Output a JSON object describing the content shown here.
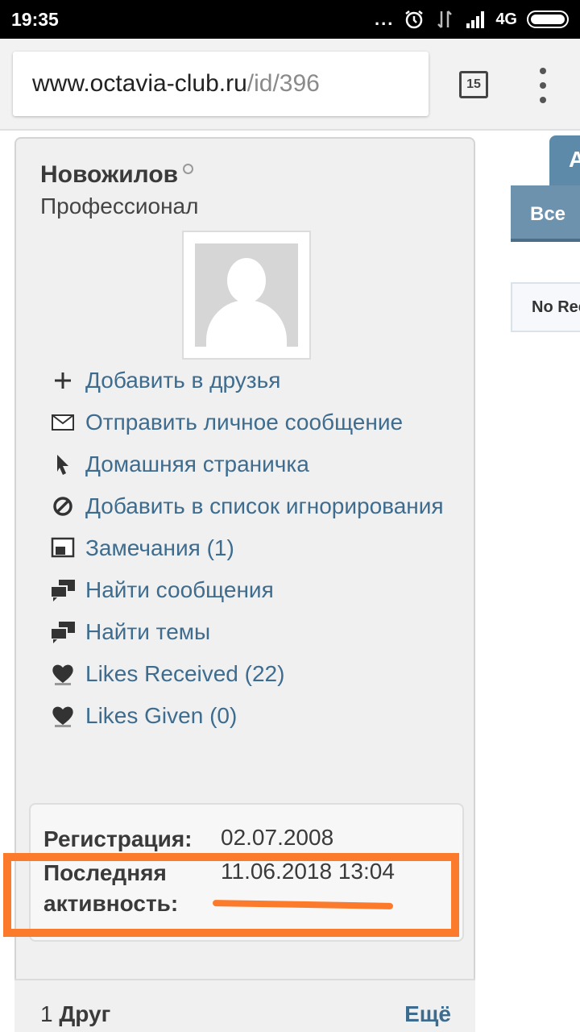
{
  "status_bar": {
    "time": "19:35",
    "dots": "...",
    "network": "4G"
  },
  "browser": {
    "url_host": "www.octavia-club.ru",
    "url_path": "/id/396",
    "tab_count": "15"
  },
  "profile": {
    "username": "Новожилов",
    "user_title": "Профессионал",
    "actions": [
      {
        "icon": "plus-icon",
        "label": "Добавить в друзья"
      },
      {
        "icon": "envelope-icon",
        "label": "Отправить личное сообщение"
      },
      {
        "icon": "cursor-icon",
        "label": "Домашняя страничка"
      },
      {
        "icon": "ban-icon",
        "label": "Добавить в список игнорирования"
      },
      {
        "icon": "warning-icon",
        "label": "Замечания (1)"
      },
      {
        "icon": "chat-icon",
        "label": "Найти сообщения"
      },
      {
        "icon": "chat-icon",
        "label": "Найти темы"
      },
      {
        "icon": "heart-icon",
        "label": "Likes Received (22)"
      },
      {
        "icon": "heart-icon",
        "label": "Likes Given (0)"
      }
    ],
    "info": {
      "registration_label": "Регистрация:",
      "registration_value": "02.07.2008",
      "last_activity_label": "Последняя активность:",
      "last_activity_value": "11.06.2018 13:04"
    },
    "friends": {
      "count": "1",
      "label": "Друг",
      "more": "Ещё"
    }
  },
  "right_panel": {
    "tab_partial": "A",
    "filter_tab": "Все",
    "no_records_partial": "No Rec"
  },
  "colors": {
    "link": "#3d6c8f",
    "highlight": "#fb7a2c",
    "tab": "#5e8aa9"
  }
}
